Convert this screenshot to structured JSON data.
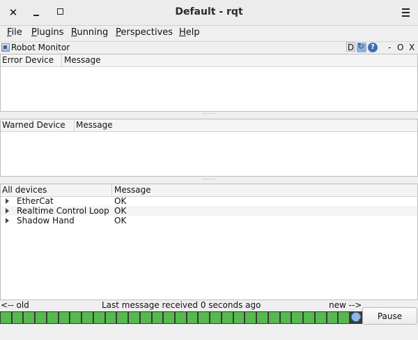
{
  "window": {
    "title": "Default - rqt"
  },
  "menu": [
    {
      "label": "File",
      "key": "F",
      "rest": "ile"
    },
    {
      "label": "Plugins",
      "key": "P",
      "rest": "lugins"
    },
    {
      "label": "Running",
      "key": "R",
      "rest": "unning"
    },
    {
      "label": "Perspectives",
      "key": "P",
      "rest": "erspectives"
    },
    {
      "label": "Help",
      "key": "H",
      "rest": "elp"
    }
  ],
  "dock": {
    "title": "Robot Monitor",
    "d_label": "D",
    "minimize_label": "-",
    "float_label": "O",
    "close_label": "X",
    "help_label": "?"
  },
  "error_panel": {
    "col1": "Error Device",
    "col2": "Message"
  },
  "warn_panel": {
    "col1": "Warned Device",
    "col2": "Message"
  },
  "all_panel": {
    "col1": "All devices",
    "col2": "Message",
    "rows": [
      {
        "device": "EtherCat",
        "message": "OK"
      },
      {
        "device": "Realtime Control Loop",
        "message": "OK"
      },
      {
        "device": "Shadow Hand",
        "message": "OK"
      }
    ]
  },
  "status": {
    "old": "<-- old",
    "last_message": "Last message received 0 seconds ago",
    "new": "new -->"
  },
  "timeline": {
    "segment_count": 30,
    "color": "#56b84f"
  },
  "pause_label": "Pause",
  "colors": {
    "ok_green": "#56b84f",
    "background": "#efefef"
  }
}
